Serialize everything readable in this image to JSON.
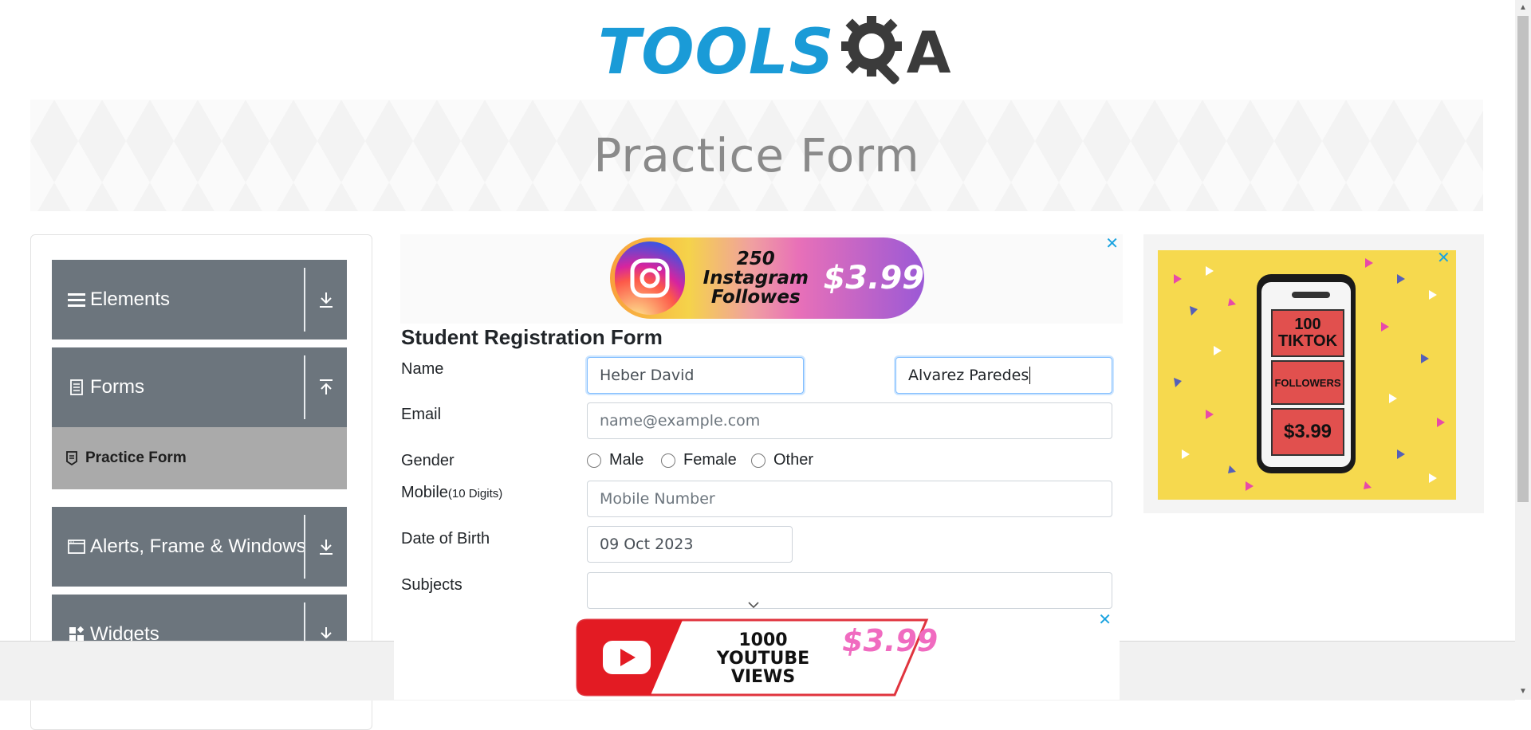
{
  "logo": {
    "brand_left": "TOOLS",
    "brand_right": "A"
  },
  "banner": {
    "title": "Practice Form"
  },
  "sidebar": {
    "groups": [
      {
        "label": "Elements",
        "icon": "hamburger-icon",
        "state": "collapsed"
      },
      {
        "label": "Forms",
        "icon": "document-icon",
        "state": "expanded"
      },
      {
        "label": "Alerts, Frame & Windows",
        "icon": "window-icon",
        "state": "collapsed"
      },
      {
        "label": "Widgets",
        "icon": "widgets-icon",
        "state": "collapsed"
      }
    ],
    "active_item": {
      "label": "Practice Form",
      "icon": "form-icon"
    }
  },
  "ads": {
    "top": {
      "line1": "250 Instagram",
      "line2": "Followes",
      "price": "$3.99",
      "close": "✕"
    },
    "right": {
      "box1_num": "100",
      "box1_text": "TIKTOK",
      "box2_text": "FOLLOWERS",
      "box3_text": "$3.99",
      "close": "✕"
    },
    "bottom": {
      "line1": "1000",
      "line2": "YOUTUBE VIEWS",
      "price": "$3.99",
      "close": "✕"
    }
  },
  "form": {
    "title": "Student Registration Form",
    "name_label": "Name",
    "first_name_value": "Heber David",
    "last_name_value": "Alvarez Paredes",
    "email_label": "Email",
    "email_placeholder": "name@example.com",
    "gender_label": "Gender",
    "gender_options": [
      "Male",
      "Female",
      "Other"
    ],
    "mobile_label": "Mobile",
    "mobile_hint": "(10 Digits)",
    "mobile_placeholder": "Mobile Number",
    "dob_label": "Date of Birth",
    "dob_value": "09 Oct 2023",
    "subjects_label": "Subjects"
  },
  "colors": {
    "brand_blue": "#1a9bd7",
    "sidebar_group": "#6c757d",
    "active_item": "#aaaaaa",
    "ad_close": "#1aa3e0"
  }
}
